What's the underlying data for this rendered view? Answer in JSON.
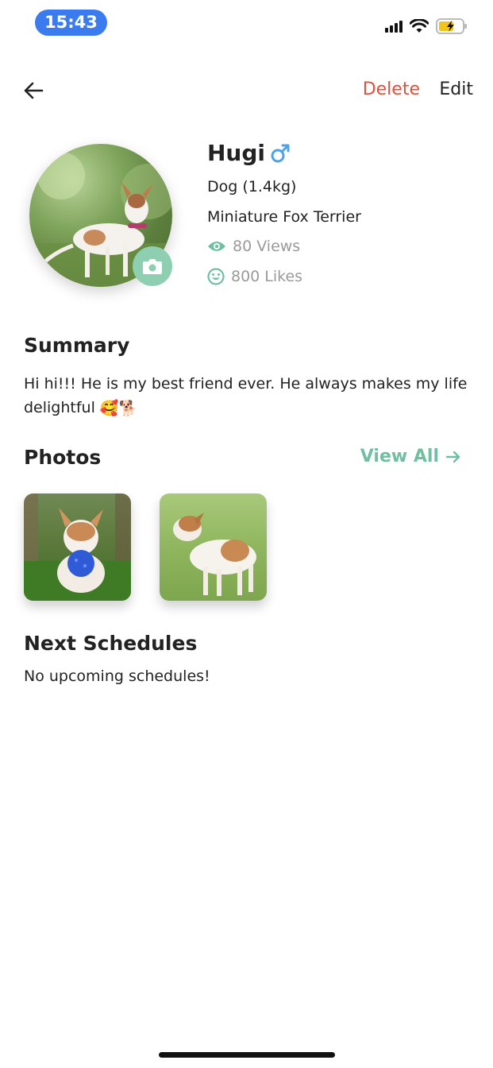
{
  "status_bar": {
    "time": "15:43",
    "icons": [
      "signal-icon",
      "wifi-icon",
      "battery-charging-icon"
    ]
  },
  "nav": {
    "back_icon": "arrow-left-icon",
    "delete_label": "Delete",
    "edit_label": "Edit"
  },
  "pet": {
    "name": "Hugi",
    "gender_icon": "male-icon",
    "species": "Dog (1.4kg)",
    "breed": "Miniature Fox Terrier",
    "views": "80 Views",
    "likes": "800 Likes",
    "avatar_icon": "camera-icon"
  },
  "summary": {
    "title": "Summary",
    "text": "Hi hi!!! He is my best friend ever. He always makes my life delightful",
    "emojis": "🥰🐕"
  },
  "photos": {
    "title": "Photos",
    "view_all_label": "View All",
    "items": [
      {
        "alt": "dog with blue ball"
      },
      {
        "alt": "dog standing on grass"
      }
    ]
  },
  "schedules": {
    "title": "Next Schedules",
    "empty_text": "No upcoming schedules!"
  },
  "colors": {
    "accent": "#6fbfa0",
    "delete": "#e0503c",
    "status_pill": "#3a7bf0",
    "gender": "#4aa3e8"
  }
}
